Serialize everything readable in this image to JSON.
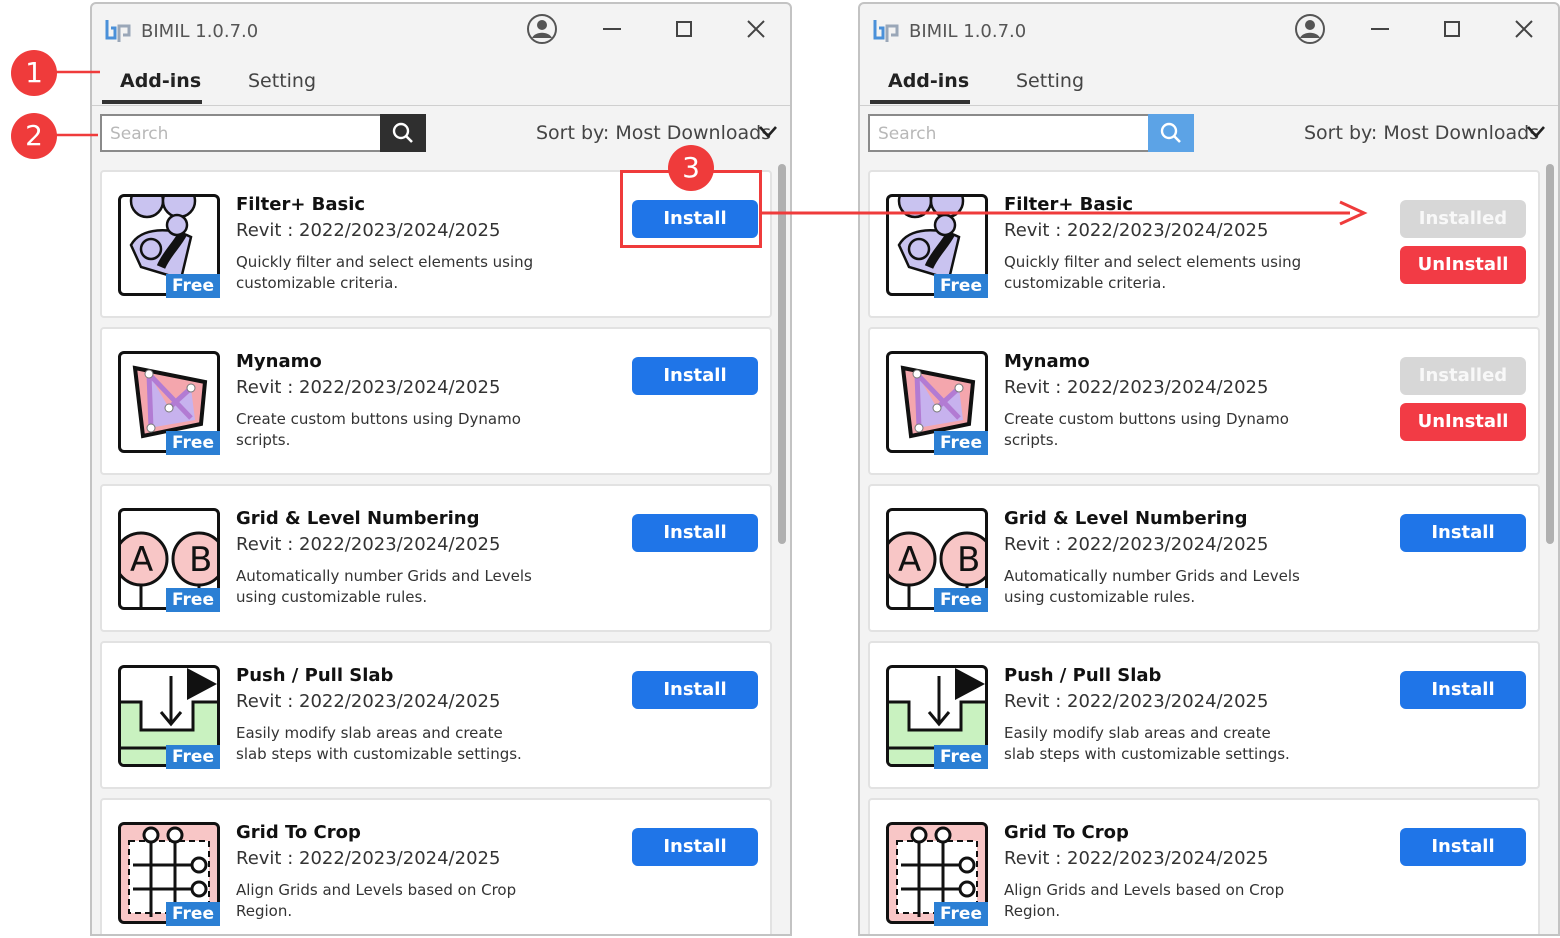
{
  "app": {
    "title": "BIMIL 1.0.7.0"
  },
  "tabs": [
    {
      "label": "Add-ins"
    },
    {
      "label": "Setting"
    }
  ],
  "search": {
    "placeholder": "Search"
  },
  "sort": {
    "label": "Sort by: Most Downloads"
  },
  "badge": {
    "free": "Free"
  },
  "buttons": {
    "install": "Install",
    "installed": "Installed",
    "uninstall": "UnInstall"
  },
  "addins": [
    {
      "title": "Filter+ Basic",
      "versions": "Revit : 2022/2023/2024/2025",
      "description": "Quickly filter and select elements using customizable criteria.",
      "icon": "filter-plus-icon"
    },
    {
      "title": "Mynamo",
      "versions": "Revit : 2022/2023/2024/2025",
      "description": "Create custom buttons using Dynamo scripts.",
      "icon": "mynamo-icon"
    },
    {
      "title": "Grid & Level Numbering",
      "versions": "Revit : 2022/2023/2024/2025",
      "description": "Automatically number Grids and Levels using customizable rules.",
      "icon": "grid-level-numbering-icon"
    },
    {
      "title": "Push / Pull Slab",
      "versions": "Revit : 2022/2023/2024/2025",
      "description": "Easily modify slab areas and create slab steps with customizable settings.",
      "icon": "push-pull-slab-icon"
    },
    {
      "title": "Grid To Crop",
      "versions": "Revit : 2022/2023/2024/2025",
      "description": "Align Grids and Levels based on Crop Region.",
      "icon": "grid-to-crop-icon"
    }
  ],
  "callouts": [
    {
      "label": "1"
    },
    {
      "label": "2"
    },
    {
      "label": "3"
    }
  ],
  "colors": {
    "install": "#1f75e8",
    "installed": "#d7d7d7",
    "uninstall": "#f23b45",
    "free_badge": "#2b7fd4",
    "callout": "#ef3b3b"
  }
}
